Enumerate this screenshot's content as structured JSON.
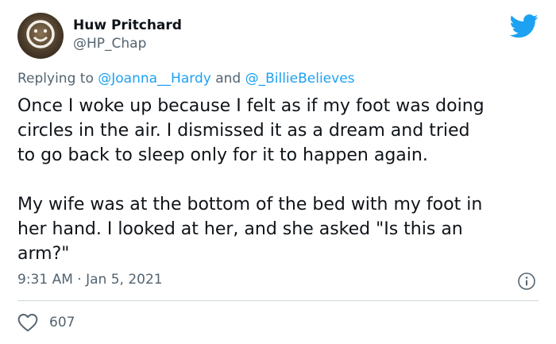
{
  "author": {
    "name": "Huw Pritchard",
    "handle": "@HP_Chap"
  },
  "reply": {
    "prefix": "Replying to",
    "mention1": "@Joanna__Hardy",
    "joiner": "and",
    "mention2": "@_BillieBelieves"
  },
  "tweet": {
    "para1": [
      "Once I woke up because I felt as if my foot was doing",
      "circles in the air. I dismissed it as a dream and tried",
      "to go back to sleep only for it to happen again."
    ],
    "para2": [
      "My wife was at the bottom of the bed with my foot in",
      "her hand. I looked at her, and she asked \"Is this an",
      "arm?\""
    ]
  },
  "meta": {
    "timestamp": "9:31 AM · Jan 5, 2021"
  },
  "stats": {
    "likes": "607"
  },
  "colors": {
    "brand": "#1da1f2",
    "secondary_text": "#536471"
  },
  "icons": {
    "brand": "twitter-bird-icon",
    "info": "info-icon",
    "like": "heart-icon"
  }
}
